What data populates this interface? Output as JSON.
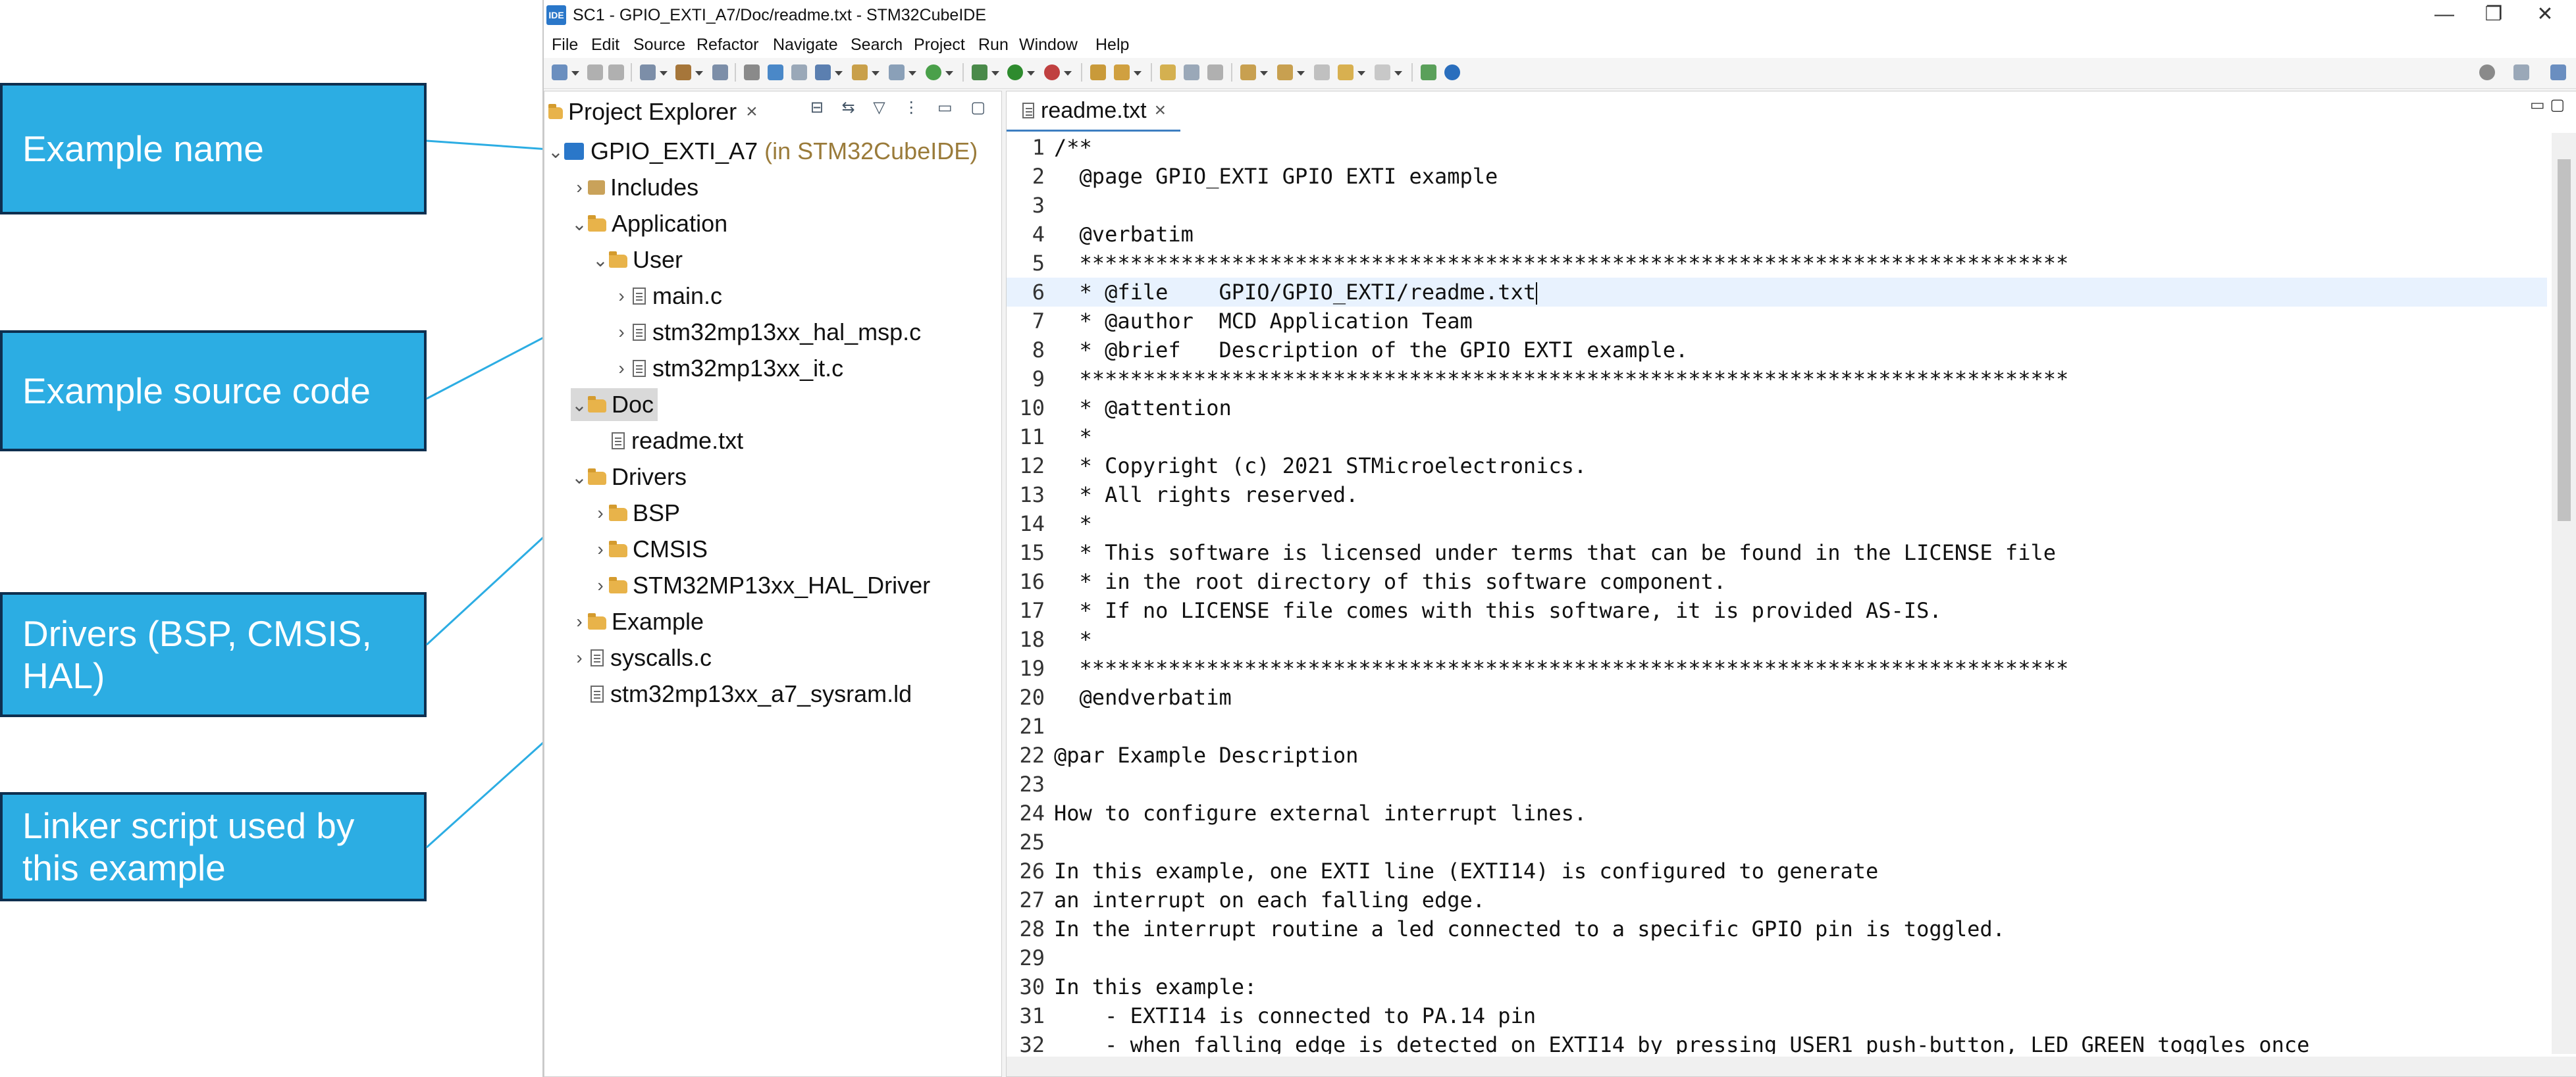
{
  "callouts": [
    {
      "id": "example-name",
      "text": "Example name"
    },
    {
      "id": "example-source",
      "text": "Example source code"
    },
    {
      "id": "drivers",
      "text": "Drivers (BSP, CMSIS, HAL)"
    },
    {
      "id": "linker",
      "text": "Linker script used by this example"
    }
  ],
  "window": {
    "app_icon": "IDE",
    "title": "SC1 - GPIO_EXTI_A7/Doc/readme.txt - STM32CubeIDE",
    "controls": {
      "minimize": "—",
      "restore": "❐",
      "close": "✕"
    }
  },
  "menu": [
    "File",
    "Edit",
    "Source",
    "Refactor",
    "Navigate",
    "Search",
    "Project",
    "Run",
    "Window",
    "Help"
  ],
  "explorer": {
    "tab_label": "Project Explorer",
    "close": "×",
    "toolbar_icons": "⊟ ⇆ ▽ ⋮ ▭ ▢",
    "tree": [
      {
        "label": "GPIO_EXTI_A7",
        "suffix": "(in STM32CubeIDE)",
        "icon": "project-icon",
        "expanded": true
      },
      {
        "label": "Includes",
        "icon": "includes-icon",
        "expanded": false
      },
      {
        "label": "Application",
        "icon": "folder-icon",
        "expanded": true
      },
      {
        "label": "User",
        "icon": "folder-icon",
        "expanded": true
      },
      {
        "label": "main.c",
        "icon": "file-icon",
        "expanded": false
      },
      {
        "label": "stm32mp13xx_hal_msp.c",
        "icon": "file-icon",
        "expanded": false
      },
      {
        "label": "stm32mp13xx_it.c",
        "icon": "file-icon",
        "expanded": false
      },
      {
        "label": "Doc",
        "icon": "folder-icon",
        "expanded": true,
        "selected": true
      },
      {
        "label": "readme.txt",
        "icon": "file-icon"
      },
      {
        "label": "Drivers",
        "icon": "folder-icon",
        "expanded": true
      },
      {
        "label": "BSP",
        "icon": "folder-icon",
        "expanded": false
      },
      {
        "label": "CMSIS",
        "icon": "folder-icon",
        "expanded": false
      },
      {
        "label": "STM32MP13xx_HAL_Driver",
        "icon": "folder-icon",
        "expanded": false
      },
      {
        "label": "Example",
        "icon": "folder-icon",
        "expanded": false
      },
      {
        "label": "syscalls.c",
        "icon": "file-icon",
        "expanded": false
      },
      {
        "label": "stm32mp13xx_a7_sysram.ld",
        "icon": "file-icon"
      }
    ]
  },
  "editor": {
    "tab_label": "readme.txt",
    "close": "×",
    "controls": "▭ ▢",
    "current_line": 6,
    "lines": [
      "/**",
      "  @page GPIO_EXTI GPIO EXTI example",
      "",
      "  @verbatim",
      "  ******************************************************************************",
      "  * @file    GPIO/GPIO_EXTI/readme.txt",
      "  * @author  MCD Application Team",
      "  * @brief   Description of the GPIO EXTI example.",
      "  ******************************************************************************",
      "  * @attention",
      "  *",
      "  * Copyright (c) 2021 STMicroelectronics.",
      "  * All rights reserved.",
      "  *",
      "  * This software is licensed under terms that can be found in the LICENSE file",
      "  * in the root directory of this software component.",
      "  * If no LICENSE file comes with this software, it is provided AS-IS.",
      "  *",
      "  ******************************************************************************",
      "  @endverbatim",
      "",
      "@par Example Description",
      "",
      "How to configure external interrupt lines.",
      "",
      "In this example, one EXTI line (EXTI14) is configured to generate",
      "an interrupt on each falling edge.",
      "In the interrupt routine a led connected to a specific GPIO pin is toggled.",
      "",
      "In this example:",
      "    - EXTI14 is connected to PA.14 pin",
      "    - when falling edge is detected on EXTI14 by pressing USER1 push-button, LED GREEN toggles once"
    ]
  }
}
